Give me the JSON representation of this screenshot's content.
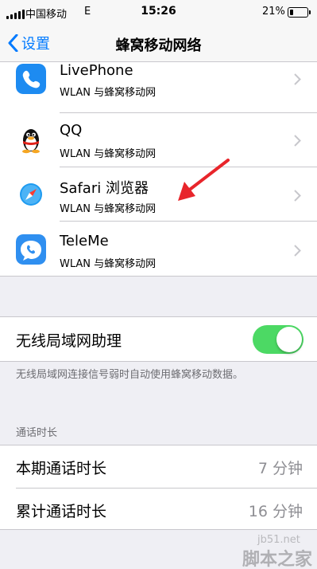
{
  "status_bar": {
    "carrier": "中国移动",
    "network": "E",
    "time": "15:26",
    "battery_percent": "21%",
    "battery_level": 0.21
  },
  "nav": {
    "back_label": "设置",
    "title": "蜂窝移动网络"
  },
  "apps": [
    {
      "name": "LivePhone",
      "subtitle": "WLAN 与蜂窝移动网",
      "icon": "phone-icon"
    },
    {
      "name": "QQ",
      "subtitle": "WLAN 与蜂窝移动网",
      "icon": "qq-penguin-icon"
    },
    {
      "name": "Safari 浏览器",
      "subtitle": "WLAN 与蜂窝移动网",
      "icon": "safari-compass-icon"
    },
    {
      "name": "TeleMe",
      "subtitle": "WLAN 与蜂窝移动网",
      "icon": "teleme-chat-phone-icon"
    }
  ],
  "wlan_assist": {
    "label": "无线局域网助理",
    "enabled": true,
    "footnote": "无线局域网连接信号弱时自动使用蜂窝移动数据。"
  },
  "call_duration": {
    "section_header": "通话时长",
    "current_label": "本期通话时长",
    "current_value": "7 分钟",
    "lifetime_label": "累计通话时长",
    "lifetime_value": "16 分钟"
  },
  "watermark": {
    "url": "jb51.net",
    "text": "脚本之家"
  },
  "colors": {
    "accent": "#007aff",
    "toggle_on": "#4cd964",
    "annotation_arrow": "#e8252b"
  }
}
